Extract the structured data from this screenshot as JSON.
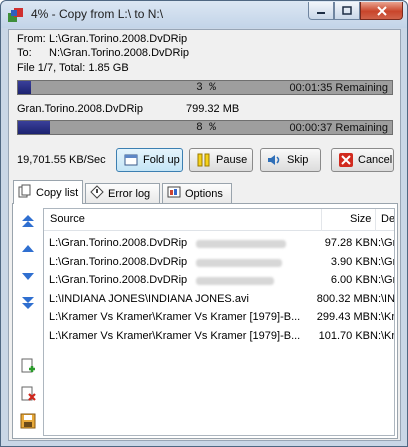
{
  "window": {
    "title": "4% - Copy from L:\\ to N:\\",
    "buttons": [
      "minimize",
      "maximize",
      "close"
    ]
  },
  "info": {
    "from_label": "From:",
    "from_value": "L:\\Gran.Torino.2008.DvDRip",
    "to_label": "To:",
    "to_value": "N:\\Gran.Torino.2008.DvDRip",
    "file_count": "File 1/7, Total: 1.85 GB"
  },
  "total_progress": {
    "percent_label": "3 %",
    "fraction": 0.035,
    "remaining": "00:01:35 Remaining"
  },
  "current_file": {
    "name": "Gran.Torino.2008.DvDRip",
    "size": "799.32 MB"
  },
  "file_progress": {
    "percent_label": "8 %",
    "fraction": 0.085,
    "remaining": "00:00:37 Remaining"
  },
  "speed": "19,701.55 KB/Sec",
  "buttons": {
    "fold_up": "Fold up",
    "pause": "Pause",
    "skip": "Skip",
    "cancel": "Cancel"
  },
  "tabs": [
    {
      "label": "Copy list",
      "icon": "copy-list-icon",
      "active": true
    },
    {
      "label": "Error log",
      "icon": "error-log-icon",
      "active": false
    },
    {
      "label": "Options",
      "icon": "options-icon",
      "active": false
    }
  ],
  "side_tools": [
    "move-top-icon",
    "move-up-icon",
    "move-down-icon",
    "move-bottom-icon",
    "add-file-icon",
    "remove-file-icon",
    "save-list-icon",
    "load-list-icon"
  ],
  "list": {
    "columns": {
      "source": "Source",
      "size": "Size",
      "destination": "Destin"
    },
    "rows": [
      {
        "source": "L:\\Gran.Torino.2008.DvDRip",
        "size": "97.28 KB",
        "destination": "N:\\Gr"
      },
      {
        "source": "L:\\Gran.Torino.2008.DvDRip",
        "size": "3.90 KB",
        "destination": "N:\\Gr"
      },
      {
        "source": "L:\\Gran.Torino.2008.DvDRip",
        "size": "6.00 KB",
        "destination": "N:\\Gr"
      },
      {
        "source": "L:\\INDIANA JONES\\INDIANA JONES.avi",
        "size": "800.32 MB",
        "destination": "N:\\IN"
      },
      {
        "source": "L:\\Kramer Vs Kramer\\Kramer Vs Kramer [1979]-B...",
        "size": "299.43 MB",
        "destination": "N:\\Kr"
      },
      {
        "source": "L:\\Kramer Vs Kramer\\Kramer Vs Kramer [1979]-B...",
        "size": "101.70 KB",
        "destination": "N:\\Kr"
      }
    ]
  }
}
